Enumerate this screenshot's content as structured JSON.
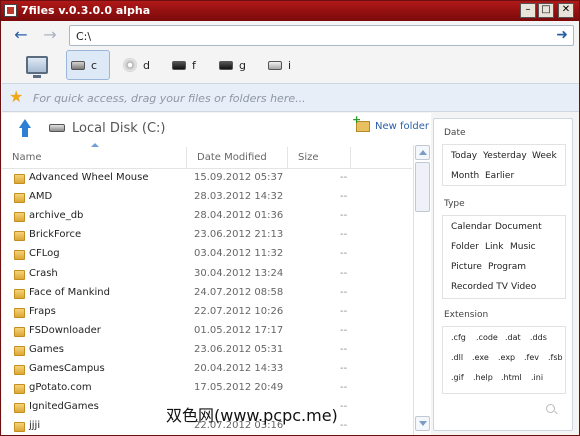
{
  "window": {
    "title": "7files v.0.3.0.0 alpha"
  },
  "address": {
    "value": "C:\\"
  },
  "drives": [
    {
      "label": "c",
      "icon": "drive-icon"
    },
    {
      "label": "d",
      "icon": "cdrom-icon"
    },
    {
      "label": "f",
      "icon": "drive-icon"
    },
    {
      "label": "g",
      "icon": "drive-icon"
    },
    {
      "label": "i",
      "icon": "drive-icon"
    }
  ],
  "favorites": {
    "hint": "For quick access, drag your files or folders here..."
  },
  "location": {
    "title": "Local Disk (C:)",
    "new_folder": "New folder"
  },
  "columns": {
    "name": "Name",
    "modified": "Date Modified",
    "size": "Size"
  },
  "files": [
    {
      "name": "Advanced Wheel Mouse",
      "date": "15.09.2012 05:37",
      "size": "--"
    },
    {
      "name": "AMD",
      "date": "28.03.2012 14:32",
      "size": "--"
    },
    {
      "name": "archive_db",
      "date": "28.04.2012 01:36",
      "size": "--"
    },
    {
      "name": "BrickForce",
      "date": "23.06.2012 21:13",
      "size": "--"
    },
    {
      "name": "CFLog",
      "date": "03.04.2012 11:32",
      "size": "--"
    },
    {
      "name": "Crash",
      "date": "30.04.2012 13:24",
      "size": "--"
    },
    {
      "name": "Face of Mankind",
      "date": "24.07.2012 08:58",
      "size": "--"
    },
    {
      "name": "Fraps",
      "date": "22.07.2012 10:26",
      "size": "--"
    },
    {
      "name": "FSDownloader",
      "date": "01.05.2012 17:17",
      "size": "--"
    },
    {
      "name": "Games",
      "date": "23.06.2012 05:31",
      "size": "--"
    },
    {
      "name": "GamesCampus",
      "date": "20.04.2012 14:33",
      "size": "--"
    },
    {
      "name": "gPotato.com",
      "date": "17.05.2012 20:49",
      "size": "--"
    },
    {
      "name": "IgnitedGames",
      "date": "",
      "size": "--"
    },
    {
      "name": "jjji",
      "date": "22.07.2012 03:16",
      "size": "--"
    }
  ],
  "filters": {
    "date_title": "Date",
    "date_options": [
      "Today",
      "Yesterday",
      "Week",
      "Month",
      "Earlier"
    ],
    "type_title": "Type",
    "type_options": [
      "Calendar",
      "Document",
      "Folder",
      "Link",
      "Music",
      "Picture",
      "Program",
      "Recorded TV",
      "Video"
    ],
    "ext_title": "Extension",
    "ext_options": [
      ".cfg",
      ".code",
      ".dat",
      ".dds",
      ".dll",
      ".exe",
      ".exp",
      ".fev",
      ".fsb",
      ".gif",
      ".help",
      ".html",
      ".ini"
    ]
  },
  "watermark": "双色网(www.pcpc.me)"
}
